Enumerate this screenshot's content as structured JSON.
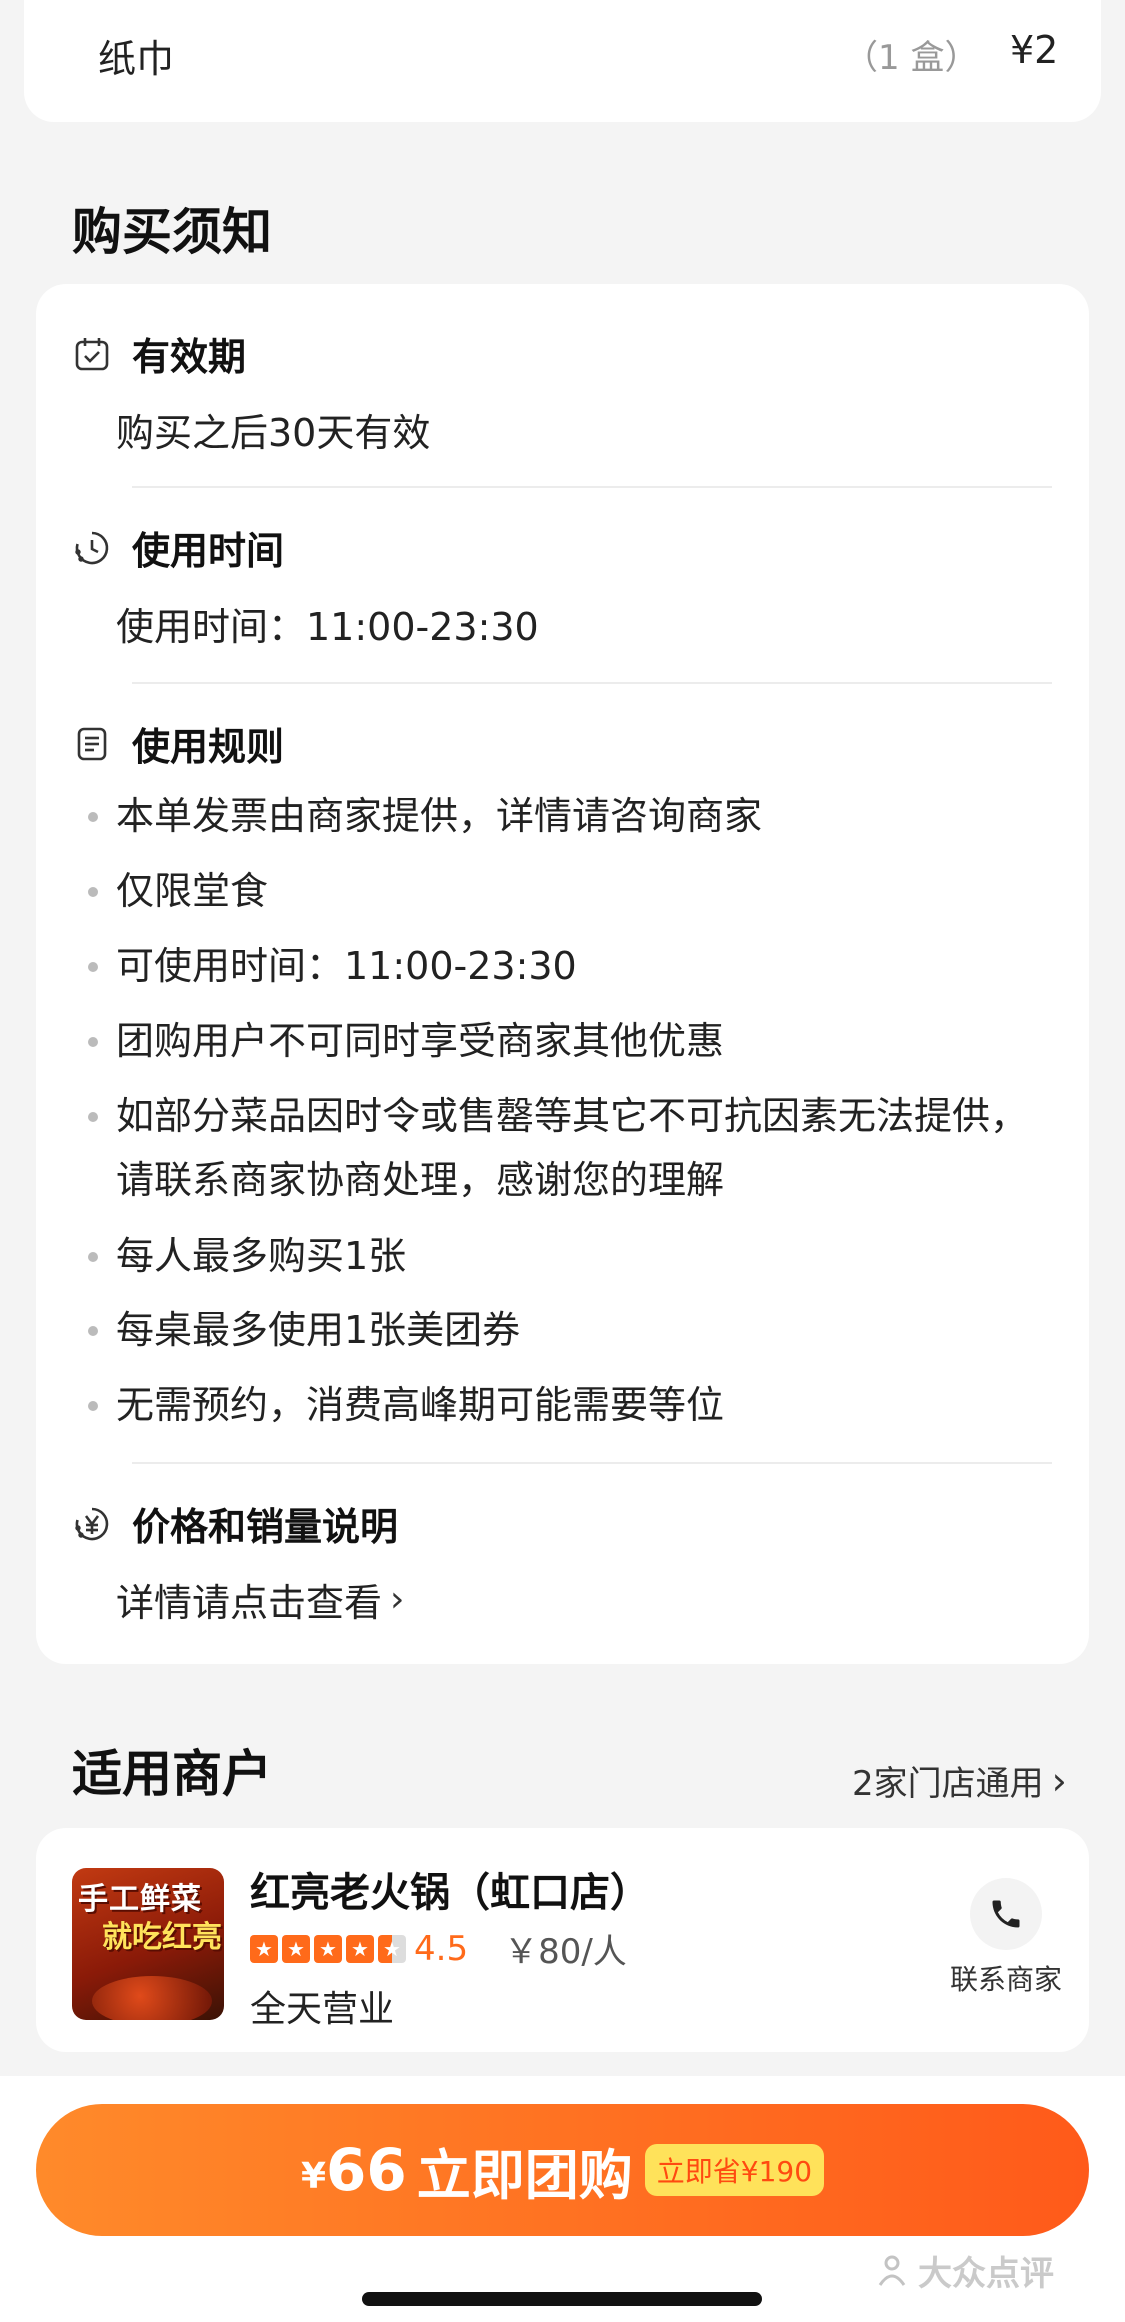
{
  "top_item": {
    "name": "纸巾",
    "quantity": "（1 盒）",
    "price": "¥2"
  },
  "notice": {
    "title": "购买须知",
    "validity": {
      "title": "有效期",
      "text": "购买之后30天有效"
    },
    "usage_time": {
      "title": "使用时间",
      "text": "使用时间：11:00-23:30"
    },
    "rules": {
      "title": "使用规则",
      "items": [
        "本单发票由商家提供，详情请咨询商家",
        "仅限堂食",
        "可使用时间：11:00-23:30",
        "团购用户不可同时享受商家其他优惠",
        "如部分菜品因时令或售罄等其它不可抗因素无法提供，请联系商家协商处理，感谢您的理解",
        "每人最多购买1张",
        "每桌最多使用1张美团券",
        "无需预约，消费高峰期可能需要等位"
      ]
    },
    "price_info": {
      "title": "价格和销量说明",
      "link": "详情请点击查看"
    }
  },
  "merchants": {
    "title": "适用商户",
    "count_label": "2家门店通用",
    "item": {
      "name": "红亮老火锅（虹口店）",
      "score": "4.5",
      "rating_stars": 4.5,
      "avg_price": "￥80/人",
      "hours": "全天营业",
      "contact_label": "联系商家",
      "thumb_text_1": "手工鲜菜",
      "thumb_text_2": "就吃红亮"
    }
  },
  "bottom": {
    "yen": "¥",
    "amount": "66",
    "buy_label": "立即团购",
    "save_badge": "立即省¥190",
    "watermark": "大众点评"
  },
  "colors": {
    "accent": "#ff6a1a",
    "save_badge_bg": "#ffe25a"
  }
}
